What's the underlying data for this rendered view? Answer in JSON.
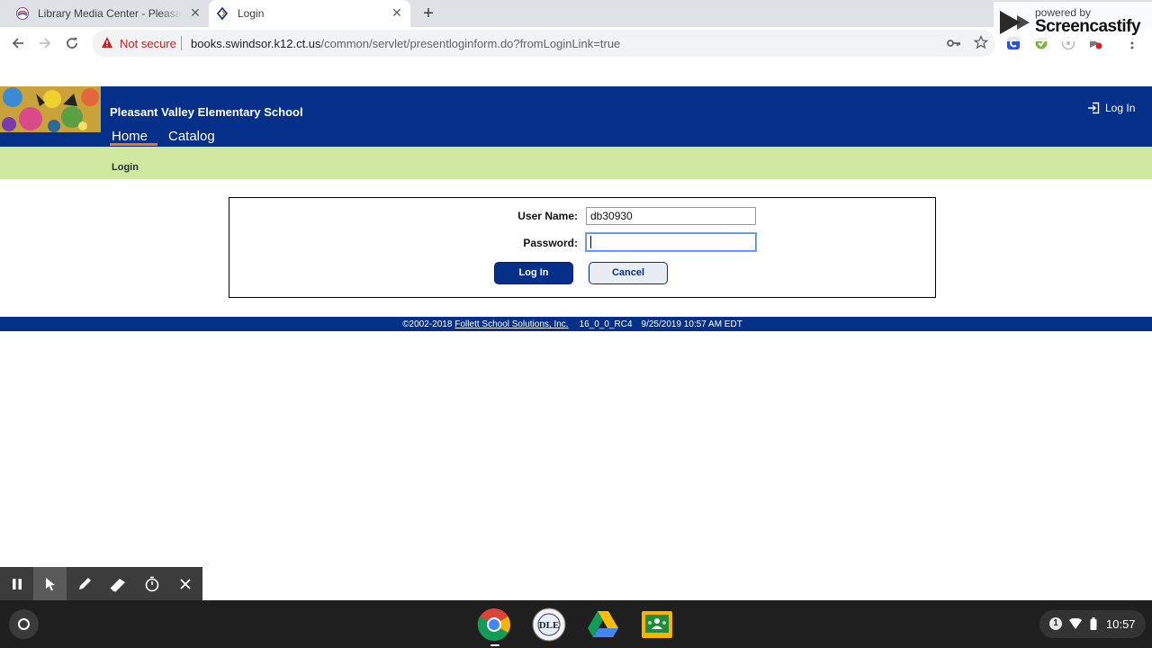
{
  "browser": {
    "tabs": [
      {
        "title": "Library Media Center - Pleasant Valley",
        "active": false
      },
      {
        "title": "Login",
        "active": true
      }
    ],
    "security_label": "Not secure",
    "url_host": "books.swindsor.k12.ct.us",
    "url_path": "/common/servlet/presentloginform.do?fromLoginLink=true"
  },
  "screencastify": {
    "powered_by": "powered by",
    "brand": "Screencastify"
  },
  "header": {
    "school_name": "Pleasant Valley Elementary School",
    "login_label": "Log In",
    "nav": [
      {
        "label": "Home",
        "active": true
      },
      {
        "label": "Catalog",
        "active": false
      }
    ]
  },
  "subbar": {
    "label": "Login"
  },
  "login_form": {
    "username_label": "User Name:",
    "username_value": "db30930",
    "password_label": "Password:",
    "password_value": "",
    "login_button": "Log In",
    "cancel_button": "Cancel"
  },
  "footer": {
    "copyright": "©2002-2018",
    "company": "Follett School Solutions, Inc.",
    "version": "16_0_0_RC4",
    "timestamp": "9/25/2019 10:57 AM EDT"
  },
  "recorder_tools": [
    "pause-icon",
    "cursor-icon",
    "pen-icon",
    "eraser-icon",
    "timer-icon",
    "close-icon"
  ],
  "shelf": {
    "apps": [
      "chrome",
      "dle-school",
      "google-drive",
      "google-classroom"
    ],
    "notification_count": "1",
    "clock": "10:57"
  },
  "colors": {
    "brand_blue": "#043089",
    "subbar_green": "#d0e8a0",
    "nav_accent": "#e87722",
    "warning_red": "#c5221f"
  }
}
